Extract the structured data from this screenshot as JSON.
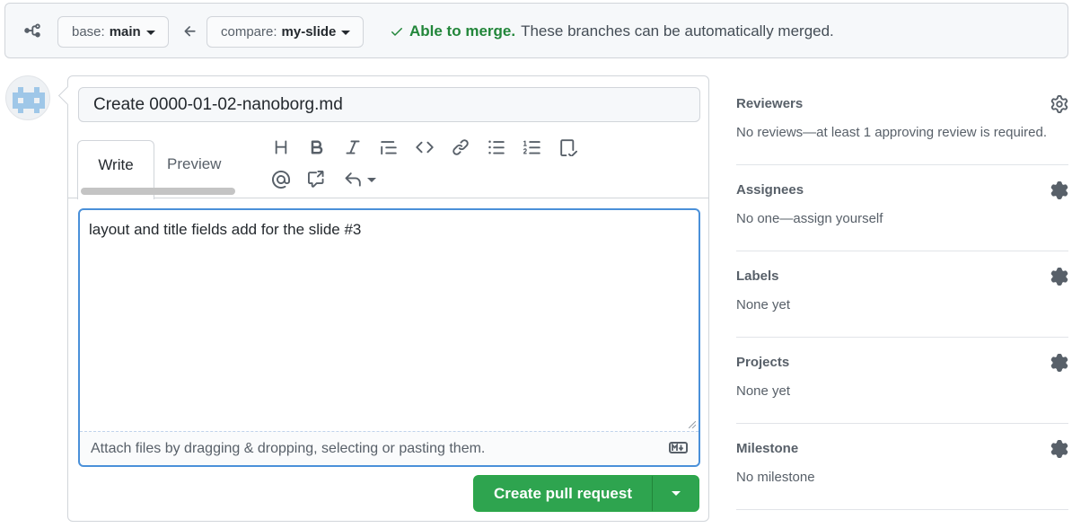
{
  "compare_bar": {
    "base_label": "base:",
    "base_branch": "main",
    "compare_label": "compare:",
    "compare_branch": "my-slide",
    "merge_ok": "Able to merge.",
    "merge_desc": "These branches can be automatically merged.",
    "status_color": "#22863a"
  },
  "editor": {
    "title_value": "Create 0000-01-02-nanoborg.md",
    "tabs": [
      {
        "label": "Write",
        "active": true
      },
      {
        "label": "Preview",
        "active": false
      }
    ],
    "toolbar_icons": [
      "heading-icon",
      "bold-icon",
      "italic-icon",
      "quote-icon",
      "code-icon",
      "link-icon",
      "bulleted-list-icon",
      "numbered-list-icon",
      "task-list-icon",
      "mention-icon",
      "reference-icon",
      "reply-icon"
    ],
    "body_text": "layout and title fields add for the slide #3",
    "attach_text": "Attach files by dragging & dropping, selecting or pasting them.",
    "submit_label": "Create pull request",
    "submit_color": "#2ea44f"
  },
  "sidebar": {
    "sections": [
      {
        "title": "Reviewers",
        "value": "No reviews—at least 1 approving review is required."
      },
      {
        "title": "Assignees",
        "value": "No one—assign yourself"
      },
      {
        "title": "Labels",
        "value": "None yet"
      },
      {
        "title": "Projects",
        "value": "None yet"
      },
      {
        "title": "Milestone",
        "value": "No milestone"
      }
    ]
  }
}
